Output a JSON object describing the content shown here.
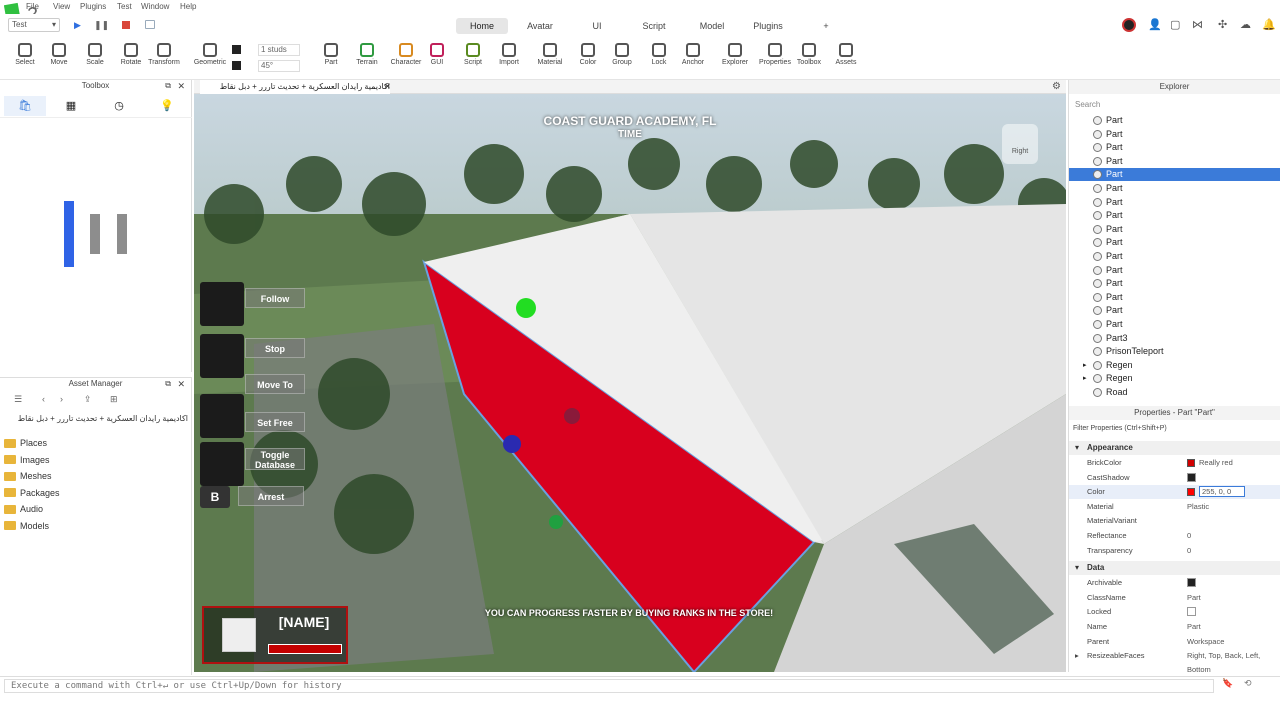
{
  "menubar": {
    "items": [
      "File",
      "View",
      "Plugins",
      "Test",
      "Window",
      "Help"
    ],
    "place_select": "Test"
  },
  "tabs": [
    "Home",
    "Avatar",
    "UI",
    "Script",
    "Model",
    "Plugins",
    "+"
  ],
  "tools": [
    {
      "label": "Select",
      "icon": "cursor-icon"
    },
    {
      "label": "Move",
      "icon": "move-icon"
    },
    {
      "label": "Scale",
      "icon": "scale-icon"
    },
    {
      "label": "Rotate",
      "icon": "rotate-icon"
    },
    {
      "label": "Transform",
      "icon": "transform-icon"
    },
    {
      "label": "Geometric",
      "icon": "geometric-icon"
    },
    {
      "label": "Part",
      "icon": "part-icon"
    },
    {
      "label": "Terrain",
      "icon": "terrain-icon"
    },
    {
      "label": "Character",
      "icon": "character-icon"
    },
    {
      "label": "GUI",
      "icon": "gui-icon"
    },
    {
      "label": "Script",
      "icon": "script-icon"
    },
    {
      "label": "Import",
      "icon": "import-icon"
    },
    {
      "label": "Material",
      "icon": "material-icon"
    },
    {
      "label": "Color",
      "icon": "color-icon"
    },
    {
      "label": "Group",
      "icon": "group-icon"
    },
    {
      "label": "Lock",
      "icon": "lock-icon"
    },
    {
      "label": "Anchor",
      "icon": "anchor-icon"
    },
    {
      "label": "Explorer",
      "icon": "explorer-icon"
    },
    {
      "label": "Properties",
      "icon": "properties-icon"
    },
    {
      "label": "Toolbox",
      "icon": "toolbox-icon"
    },
    {
      "label": "Assets",
      "icon": "assets-icon"
    }
  ],
  "snap": {
    "studs": "1 studs",
    "angle": "45°"
  },
  "toolbox": {
    "title": "Toolbox"
  },
  "asset_manager": {
    "title": "Asset Manager",
    "place_name": "اكاديمية رايدان العسكرية + تحديث تاررر + دبل نقاط",
    "folders": [
      "Places",
      "Images",
      "Meshes",
      "Packages",
      "Audio",
      "Models"
    ]
  },
  "doc_tab": {
    "title": "اكاديمية رايدان العسكرية + تحديث تاررر + دبل نقاط"
  },
  "game": {
    "title": "COAST GUARD ACADEMY, FL",
    "time": "TIME",
    "nav_view": "Right",
    "buttons": [
      "Follow",
      "Stop",
      "Move To",
      "Set Free",
      "Toggle Database",
      "Arrest"
    ],
    "key_hint": "B",
    "player_name": "[NAME]",
    "banner": "YOU CAN PROGRESS FASTER BY BUYING RANKS IN THE STORE!"
  },
  "explorer": {
    "title": "Explorer",
    "search_placeholder": "Search",
    "items": [
      {
        "label": "Part",
        "selected": false,
        "expand": false
      },
      {
        "label": "Part",
        "selected": false,
        "expand": false
      },
      {
        "label": "Part",
        "selected": false,
        "expand": false
      },
      {
        "label": "Part",
        "selected": false,
        "expand": false
      },
      {
        "label": "Part",
        "selected": true,
        "expand": false
      },
      {
        "label": "Part",
        "selected": false,
        "expand": false
      },
      {
        "label": "Part",
        "selected": false,
        "expand": false
      },
      {
        "label": "Part",
        "selected": false,
        "expand": false
      },
      {
        "label": "Part",
        "selected": false,
        "expand": false
      },
      {
        "label": "Part",
        "selected": false,
        "expand": false
      },
      {
        "label": "Part",
        "selected": false,
        "expand": false
      },
      {
        "label": "Part",
        "selected": false,
        "expand": false
      },
      {
        "label": "Part",
        "selected": false,
        "expand": false
      },
      {
        "label": "Part",
        "selected": false,
        "expand": false
      },
      {
        "label": "Part",
        "selected": false,
        "expand": false
      },
      {
        "label": "Part",
        "selected": false,
        "expand": false
      },
      {
        "label": "Part3",
        "selected": false,
        "expand": false
      },
      {
        "label": "PrisonTeleport",
        "selected": false,
        "expand": false
      },
      {
        "label": "Regen",
        "selected": false,
        "expand": true
      },
      {
        "label": "Regen",
        "selected": false,
        "expand": true
      },
      {
        "label": "Road",
        "selected": false,
        "expand": false
      }
    ]
  },
  "properties": {
    "title": "Properties - Part \"Part\"",
    "filter_placeholder": "Filter Properties (Ctrl+Shift+P)",
    "sections": [
      {
        "name": "Appearance",
        "rows": [
          {
            "key": "BrickColor",
            "value": "Really red",
            "swatch": "#d10000",
            "type": "color"
          },
          {
            "key": "CastShadow",
            "value": "",
            "type": "check",
            "checked": true
          },
          {
            "key": "Color",
            "value": "255, 0, 0",
            "swatch": "#ff0000",
            "type": "color",
            "editing": true
          },
          {
            "key": "Material",
            "value": "Plastic",
            "type": "text"
          },
          {
            "key": "MaterialVariant",
            "value": "",
            "type": "text"
          },
          {
            "key": "Reflectance",
            "value": "0",
            "type": "text"
          },
          {
            "key": "Transparency",
            "value": "0",
            "type": "text"
          }
        ]
      },
      {
        "name": "Data",
        "rows": [
          {
            "key": "Archivable",
            "value": "",
            "type": "check",
            "checked": true
          },
          {
            "key": "ClassName",
            "value": "Part",
            "type": "text"
          },
          {
            "key": "Locked",
            "value": "",
            "type": "check",
            "checked": false
          },
          {
            "key": "Name",
            "value": "Part",
            "type": "text"
          },
          {
            "key": "Parent",
            "value": "Workspace",
            "type": "text"
          },
          {
            "key": "ResizeableFaces",
            "value": "Right, Top, Back, Left, Bottom",
            "type": "text",
            "expand": true
          }
        ]
      }
    ]
  },
  "command_bar": {
    "placeholder": "Execute a command with Ctrl+↵ or use Ctrl+Up/Down for history"
  },
  "colors": {
    "accent": "#3b7bd9",
    "red_part": "#d8001e"
  }
}
